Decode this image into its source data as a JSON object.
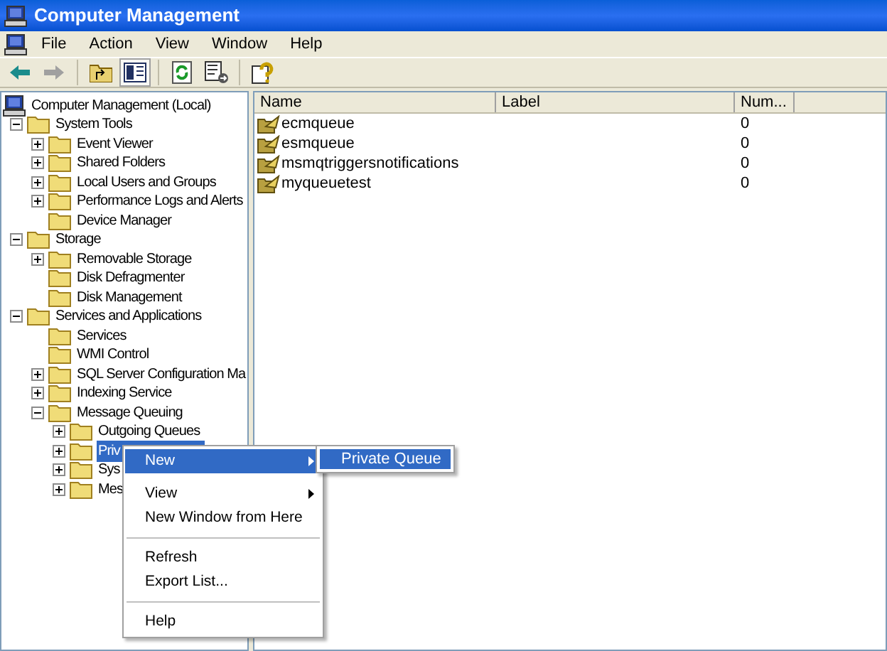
{
  "window": {
    "title": "Computer Management"
  },
  "menu_bar": [
    "File",
    "Action",
    "View",
    "Window",
    "Help"
  ],
  "toolbar": [
    {
      "kind": "back",
      "disabled": false,
      "pressed": false
    },
    {
      "kind": "forward",
      "disabled": true,
      "pressed": false
    },
    {
      "kind": "separator"
    },
    {
      "kind": "up",
      "pressed": false
    },
    {
      "kind": "tree",
      "pressed": true
    },
    {
      "kind": "separator"
    },
    {
      "kind": "refresh",
      "pressed": false
    },
    {
      "kind": "export",
      "pressed": false
    },
    {
      "kind": "separator"
    },
    {
      "kind": "help",
      "pressed": false
    }
  ],
  "tree": {
    "label": "Computer Management (Local)",
    "children": [
      {
        "label": "System Tools",
        "expanded": true,
        "children": [
          {
            "label": "Event Viewer",
            "expanded": false
          },
          {
            "label": "Shared Folders",
            "expanded": false
          },
          {
            "label": "Local Users and Groups",
            "expanded": false
          },
          {
            "label": "Performance Logs and Alerts",
            "expanded": false
          },
          {
            "label": "Device Manager"
          }
        ]
      },
      {
        "label": "Storage",
        "expanded": true,
        "children": [
          {
            "label": "Removable Storage",
            "expanded": false
          },
          {
            "label": "Disk Defragmenter"
          },
          {
            "label": "Disk Management"
          }
        ]
      },
      {
        "label": "Services and Applications",
        "expanded": true,
        "children": [
          {
            "label": "Services"
          },
          {
            "label": "WMI Control"
          },
          {
            "label": "SQL Server Configuration Ma",
            "expanded": false
          },
          {
            "label": "Indexing Service",
            "expanded": false
          },
          {
            "label": "Message Queuing",
            "expanded": true,
            "children": [
              {
                "label": "Outgoing Queues",
                "expanded": false,
                "selected": false
              },
              {
                "label": "Priv",
                "expanded": false,
                "selected": true
              },
              {
                "label": "Sys",
                "expanded": false,
                "selected": false
              },
              {
                "label": "Mes",
                "expanded": false,
                "selected": false
              }
            ]
          }
        ]
      }
    ]
  },
  "list": {
    "columns": [
      "Name",
      "Label",
      "Num..."
    ],
    "rows": [
      {
        "name": "ecmqueue",
        "count": "0"
      },
      {
        "name": "esmqueue",
        "count": "0"
      },
      {
        "name": "msmqtriggersnotifications",
        "count": "0"
      },
      {
        "name": "myqueuetest",
        "count": "0"
      }
    ]
  },
  "context_menu": [
    {
      "kind": "item",
      "label": "New",
      "submenu": true,
      "selected": true
    },
    {
      "kind": "item",
      "label": "View",
      "submenu": true,
      "selected": false
    },
    {
      "kind": "item",
      "label": "New Window from Here",
      "submenu": false,
      "selected": false
    },
    {
      "kind": "separator"
    },
    {
      "kind": "item",
      "label": "Refresh",
      "submenu": false,
      "selected": false
    },
    {
      "kind": "item",
      "label": "Export List...",
      "submenu": false,
      "selected": false
    },
    {
      "kind": "separator"
    },
    {
      "kind": "item",
      "label": "Help",
      "submenu": false,
      "selected": false
    }
  ],
  "submenu": [
    {
      "label": "Private Queue",
      "selected": true
    }
  ]
}
